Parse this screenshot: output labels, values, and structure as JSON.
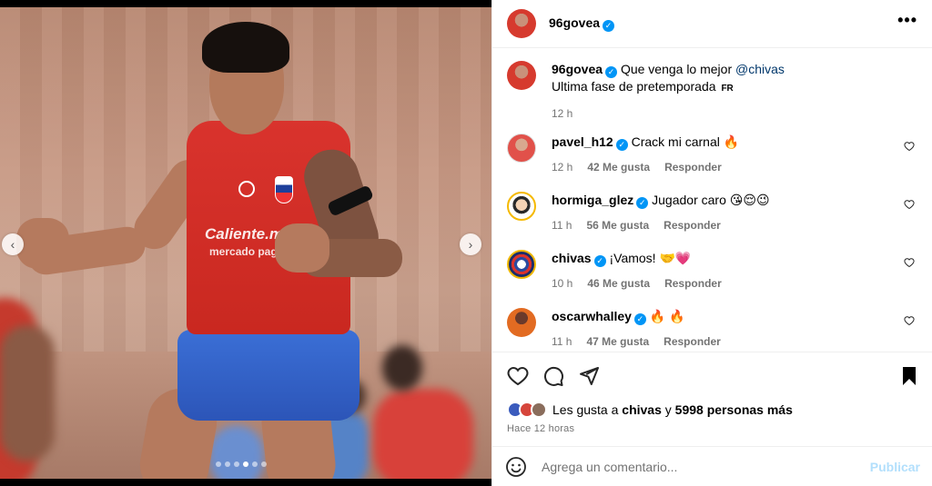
{
  "post": {
    "author": "96govea",
    "caption": {
      "text": "Que venga lo mejor",
      "mention": "@chivas",
      "line2": "Ultima fase de pretemporada",
      "flag": "FR",
      "time": "12 h"
    },
    "media": {
      "shirt_brand": "Caliente.mx",
      "shirt_sponsor": "mercado pago",
      "dots_total": 6,
      "active_dot": 4
    }
  },
  "comments": [
    {
      "user": "pavel_h12",
      "verified": true,
      "text": "Crack mi carnal",
      "emoji": "🔥",
      "time": "12 h",
      "likes": "42 Me gusta",
      "reply": "Responder"
    },
    {
      "user": "hormiga_glez",
      "verified": true,
      "text": "Jugador caro",
      "emoji": "😘😌😉",
      "time": "11 h",
      "likes": "56 Me gusta",
      "reply": "Responder"
    },
    {
      "user": "chivas",
      "verified": true,
      "text": "¡Vamos!",
      "emoji": "🤝💗",
      "time": "10 h",
      "likes": "46 Me gusta",
      "reply": "Responder"
    },
    {
      "user": "oscarwhalley",
      "verified": true,
      "text": "",
      "emoji": "🔥 🔥",
      "time": "11 h",
      "likes": "47 Me gusta",
      "reply": "Responder"
    }
  ],
  "likes": {
    "prefix": "Les gusta a",
    "user": "chivas",
    "conj": "y",
    "rest": "5998 personas más"
  },
  "posted_ago": "Hace 12 horas",
  "add_comment": {
    "placeholder": "Agrega un comentario...",
    "publish": "Publicar"
  },
  "icons": {
    "more": "more-options-icon",
    "like": "heart-icon",
    "comment": "comment-bubble-icon",
    "share": "paper-plane-icon",
    "save": "bookmark-icon",
    "emoji": "emoji-smile-icon"
  },
  "colors": {
    "verified": "#0095f6",
    "publish_disabled": "#b2dffc",
    "meta_text": "#737373"
  }
}
